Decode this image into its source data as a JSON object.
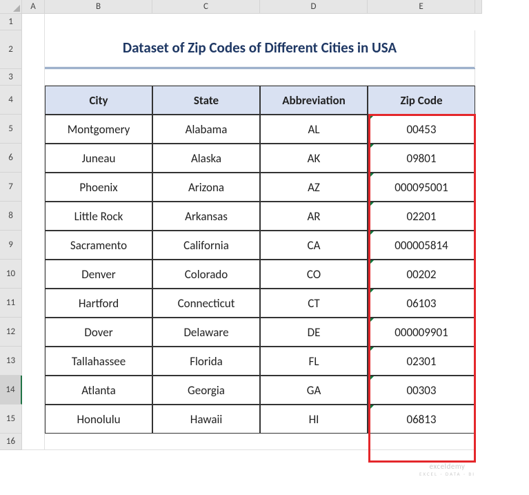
{
  "columns": [
    "A",
    "B",
    "C",
    "D",
    "E"
  ],
  "rows": [
    "1",
    "2",
    "3",
    "4",
    "5",
    "6",
    "7",
    "8",
    "9",
    "10",
    "11",
    "12",
    "13",
    "14",
    "15",
    "16"
  ],
  "title": "Dataset of Zip Codes of Different Cities in USA",
  "headers": {
    "city": "City",
    "state": "State",
    "abbr": "Abbreviation",
    "zip": "Zip Code"
  },
  "data": [
    {
      "city": "Montgomery",
      "state": "Alabama",
      "abbr": "AL",
      "zip": "00453"
    },
    {
      "city": "Juneau",
      "state": "Alaska",
      "abbr": "AK",
      "zip": "09801"
    },
    {
      "city": "Phoenix",
      "state": "Arizona",
      "abbr": "AZ",
      "zip": "000095001"
    },
    {
      "city": "Little Rock",
      "state": "Arkansas",
      "abbr": "AR",
      "zip": "02201"
    },
    {
      "city": "Sacramento",
      "state": "California",
      "abbr": "CA",
      "zip": "000005814"
    },
    {
      "city": "Denver",
      "state": "Colorado",
      "abbr": "CO",
      "zip": "00202"
    },
    {
      "city": "Hartford",
      "state": "Connecticut",
      "abbr": "CT",
      "zip": "06103"
    },
    {
      "city": "Dover",
      "state": "Delaware",
      "abbr": "DE",
      "zip": "000009901"
    },
    {
      "city": "Tallahassee",
      "state": "Florida",
      "abbr": "FL",
      "zip": "02301"
    },
    {
      "city": "Atlanta",
      "state": "Georgia",
      "abbr": "GA",
      "zip": "00303"
    },
    {
      "city": "Honolulu",
      "state": "Hawaii",
      "abbr": "HI",
      "zip": "06813"
    }
  ],
  "watermark": {
    "main": "exceldemy",
    "sub": "EXCEL · DATA · BI"
  },
  "selected_row": "14",
  "chart_data": {
    "type": "table",
    "title": "Dataset of Zip Codes of Different Cities in USA",
    "columns": [
      "City",
      "State",
      "Abbreviation",
      "Zip Code"
    ],
    "rows": [
      [
        "Montgomery",
        "Alabama",
        "AL",
        "00453"
      ],
      [
        "Juneau",
        "Alaska",
        "AK",
        "09801"
      ],
      [
        "Phoenix",
        "Arizona",
        "AZ",
        "000095001"
      ],
      [
        "Little Rock",
        "Arkansas",
        "AR",
        "02201"
      ],
      [
        "Sacramento",
        "California",
        "CA",
        "000005814"
      ],
      [
        "Denver",
        "Colorado",
        "CO",
        "00202"
      ],
      [
        "Hartford",
        "Connecticut",
        "CT",
        "06103"
      ],
      [
        "Dover",
        "Delaware",
        "DE",
        "000009901"
      ],
      [
        "Tallahassee",
        "Florida",
        "FL",
        "02301"
      ],
      [
        "Atlanta",
        "Georgia",
        "GA",
        "00303"
      ],
      [
        "Honolulu",
        "Hawaii",
        "HI",
        "06813"
      ]
    ]
  }
}
